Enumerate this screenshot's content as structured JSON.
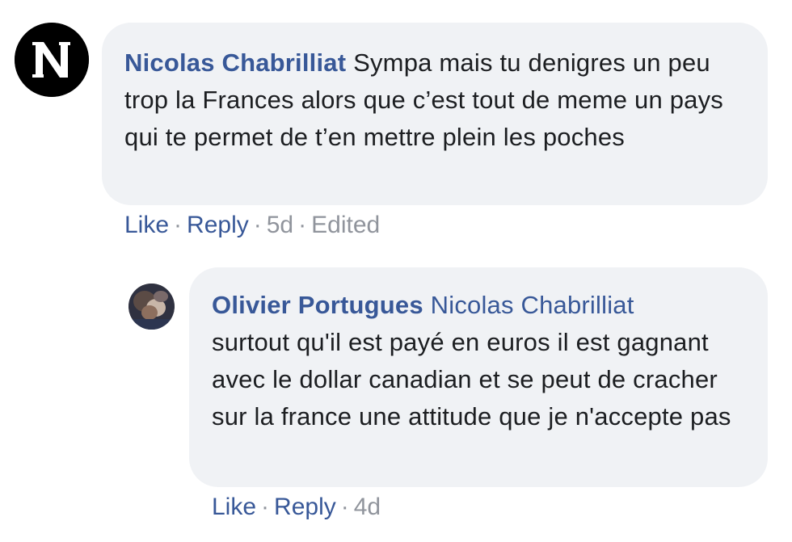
{
  "comments": [
    {
      "author": "Nicolas Chabrilliat",
      "text": "Sympa mais tu denigres un peu trop la Frances alors que c’est tout de meme un pays qui te permet de t’en mettre plein les poches",
      "actions": {
        "like": "Like",
        "reply": "Reply",
        "time": "5d",
        "edited": "Edited"
      },
      "avatar_icon": "letter-n-logo-icon"
    }
  ],
  "replies": [
    {
      "author": "Olivier Portugues",
      "mention": "Nicolas Chabrilliat",
      "text": "surtout qu'il est payé en euros il est gagnant avec le dollar canadian et se peut de cracher sur la france une attitude que je n'accepte pas",
      "actions": {
        "like": "Like",
        "reply": "Reply",
        "time": "4d"
      },
      "avatar_icon": "profile-photo"
    }
  ],
  "separator": "·",
  "colors": {
    "bubble_bg": "#f0f2f5",
    "link_blue": "#385898",
    "meta_gray": "#90949c",
    "text": "#1c1e21"
  }
}
